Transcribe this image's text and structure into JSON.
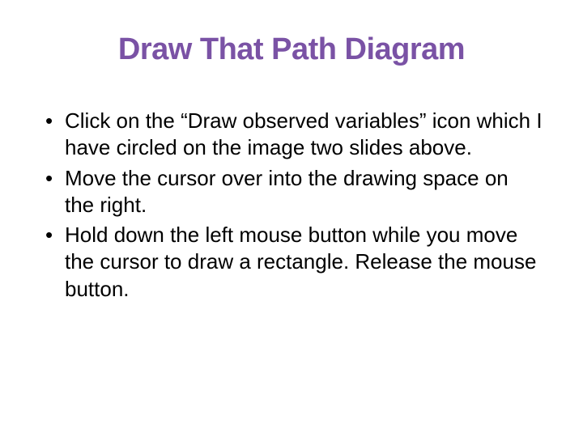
{
  "slide": {
    "title": "Draw That Path Diagram",
    "bullets": [
      "Click on the “Draw observed variables” icon which I have circled on the image two slides above.",
      "Move the cursor over into the drawing space on the right.",
      "Hold down the left mouse button while you move the cursor to draw a rectangle. Release the mouse button."
    ]
  }
}
